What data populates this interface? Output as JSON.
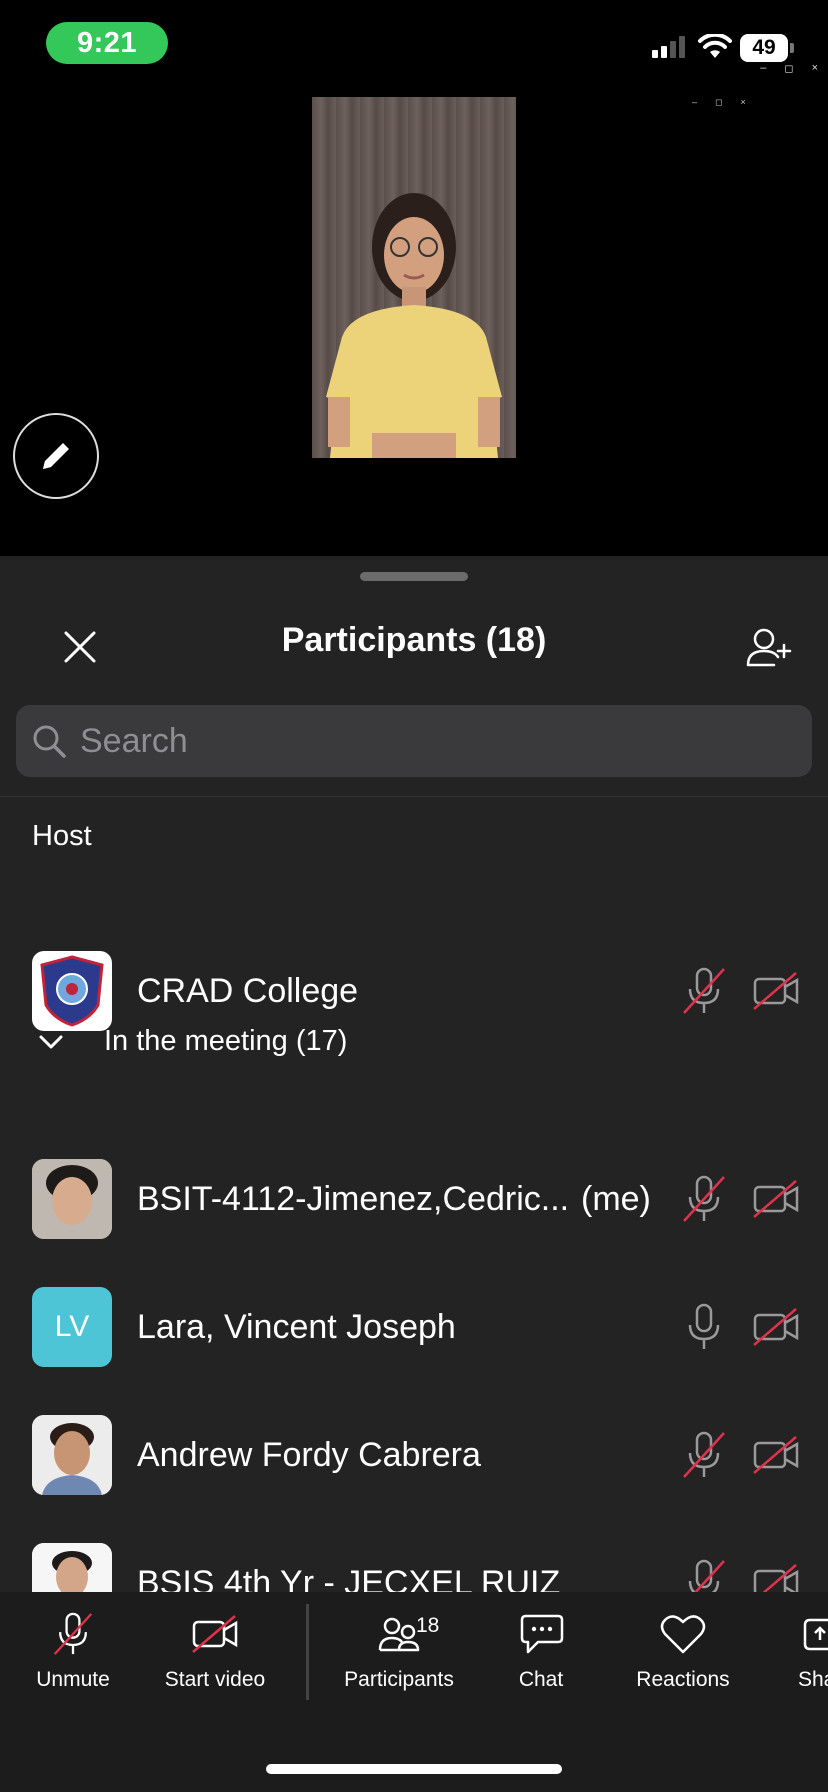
{
  "status_bar": {
    "time": "9:21",
    "battery": "49"
  },
  "window_controls": [
    "–",
    "◻",
    "×"
  ],
  "sheet": {
    "title": "Participants (18)",
    "search_placeholder": "Search",
    "host_label": "Host",
    "in_meeting_label": "In the meeting (17)"
  },
  "host": {
    "name": "CRAD College",
    "mic": "muted",
    "video": "off"
  },
  "participants": [
    {
      "name": "BSIT-4112-Jimenez,Cedric...",
      "suffix": "(me)",
      "mic": "muted",
      "video": "off"
    },
    {
      "name": "Lara, Vincent Joseph",
      "initials": "LV",
      "mic": "on",
      "video": "off",
      "avatar_color": "#4dc5d6"
    },
    {
      "name": "Andrew Fordy Cabrera",
      "mic": "muted",
      "video": "off"
    },
    {
      "name": "BSIS 4th Yr - JECXEL RUIZ",
      "mic": "muted",
      "video": "off"
    }
  ],
  "toolbar": {
    "unmute": "Unmute",
    "start_video": "Start video",
    "participants": "Participants",
    "participants_count": "18",
    "chat": "Chat",
    "reactions": "Reactions",
    "share": "Sha"
  },
  "colors": {
    "mute_red": "#e0324b",
    "status_green": "#34c759",
    "sheet_bg": "#232323"
  }
}
